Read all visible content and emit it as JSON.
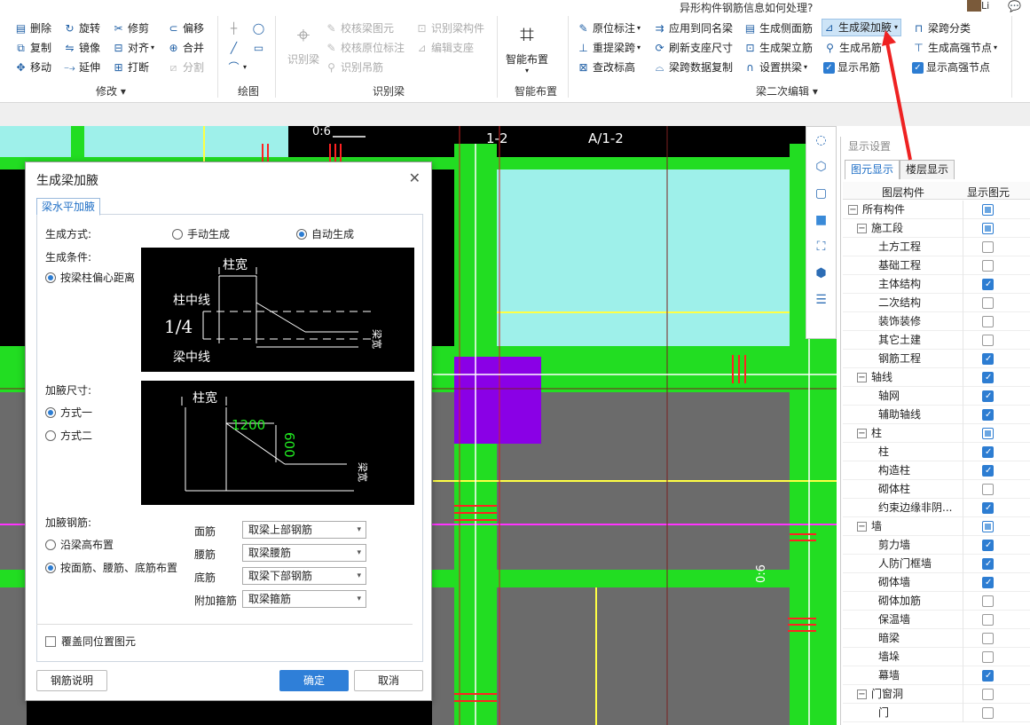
{
  "title_text": "异形构件钢筋信息如何处理?",
  "user": {
    "name": "Li"
  },
  "ribbon": {
    "modify": {
      "label": "修改",
      "buttons": [
        "删除",
        "旋转",
        "修剪",
        "偏移",
        "复制",
        "镜像",
        "对齐",
        "合并",
        "移动",
        "延伸",
        "打断",
        "分割"
      ]
    },
    "draw": {
      "label": "绘图"
    },
    "identify": {
      "label": "识别梁",
      "big_button": "识别梁",
      "buttons": [
        "校核梁图元",
        "识别梁构件",
        "校核原位标注",
        "编辑支座",
        "识别吊筋"
      ]
    },
    "smart": {
      "label": "智能布置",
      "big_button": "智能布置"
    },
    "edit2": {
      "label": "梁二次编辑",
      "buttons": [
        "原位标注",
        "应用到同名梁",
        "生成侧面筋",
        "生成梁加腋",
        "梁跨分类",
        "重提梁跨",
        "刷新支座尺寸",
        "生成架立筋",
        "生成吊筋",
        "生成高强节点",
        "查改标高",
        "梁跨数据复制",
        "设置拱梁"
      ],
      "checks": [
        "显示吊筋",
        "显示高强节点"
      ]
    }
  },
  "canvas": {
    "labels": [
      "1-2",
      "A/1-2",
      "0:6"
    ]
  },
  "panel": {
    "title": "显示设置",
    "tabs": [
      "图元显示",
      "楼层显示"
    ],
    "columns": [
      "图层构件",
      "显示图元"
    ],
    "rows": [
      {
        "label": "所有构件",
        "level": 0,
        "toggle": "−",
        "state": "part"
      },
      {
        "label": "施工段",
        "level": 1,
        "toggle": "−",
        "state": "part"
      },
      {
        "label": "土方工程",
        "level": 2,
        "state": "off"
      },
      {
        "label": "基础工程",
        "level": 2,
        "state": "off"
      },
      {
        "label": "主体结构",
        "level": 2,
        "state": "on"
      },
      {
        "label": "二次结构",
        "level": 2,
        "state": "off"
      },
      {
        "label": "装饰装修",
        "level": 2,
        "state": "off"
      },
      {
        "label": "其它土建",
        "level": 2,
        "state": "off"
      },
      {
        "label": "钢筋工程",
        "level": 2,
        "state": "on"
      },
      {
        "label": "轴线",
        "level": 1,
        "toggle": "−",
        "state": "on"
      },
      {
        "label": "轴网",
        "level": 2,
        "state": "on"
      },
      {
        "label": "辅助轴线",
        "level": 2,
        "state": "on"
      },
      {
        "label": "柱",
        "level": 1,
        "toggle": "−",
        "state": "part"
      },
      {
        "label": "柱",
        "level": 2,
        "state": "on"
      },
      {
        "label": "构造柱",
        "level": 2,
        "state": "on"
      },
      {
        "label": "砌体柱",
        "level": 2,
        "state": "off"
      },
      {
        "label": "约束边缘非阴...",
        "level": 2,
        "state": "on"
      },
      {
        "label": "墙",
        "level": 1,
        "toggle": "−",
        "state": "part"
      },
      {
        "label": "剪力墙",
        "level": 2,
        "state": "on"
      },
      {
        "label": "人防门框墙",
        "level": 2,
        "state": "on"
      },
      {
        "label": "砌体墙",
        "level": 2,
        "state": "on"
      },
      {
        "label": "砌体加筋",
        "level": 2,
        "state": "off"
      },
      {
        "label": "保温墙",
        "level": 2,
        "state": "off"
      },
      {
        "label": "暗梁",
        "level": 2,
        "state": "off"
      },
      {
        "label": "墙垛",
        "level": 2,
        "state": "off"
      },
      {
        "label": "幕墙",
        "level": 2,
        "state": "on"
      },
      {
        "label": "门窗洞",
        "level": 1,
        "toggle": "−",
        "state": "off"
      },
      {
        "label": "门",
        "level": 2,
        "state": "off"
      }
    ]
  },
  "dialog": {
    "title": "生成梁加腋",
    "tab": "梁水平加腋",
    "method_label": "生成方式:",
    "method_options": [
      "手动生成",
      "自动生成"
    ],
    "condition_label": "生成条件:",
    "condition_option": "按梁柱偏心距离",
    "size_label": "加腋尺寸:",
    "size_options": [
      "方式一",
      "方式二"
    ],
    "rebar_label": "加腋钢筋:",
    "rebar_options": [
      "沿梁高布置",
      "按面筋、腰筋、底筋布置"
    ],
    "fields": [
      {
        "label": "面筋",
        "value": "取梁上部钢筋"
      },
      {
        "label": "腰筋",
        "value": "取梁腰筋"
      },
      {
        "label": "底筋",
        "value": "取梁下部钢筋"
      },
      {
        "label": "附加箍筋",
        "value": "取梁箍筋"
      }
    ],
    "overwrite": "覆盖同位置图元",
    "diagram1": {
      "col_width": "柱宽",
      "col_center": "柱中线",
      "ratio": "1/4",
      "beam_center": "梁中线",
      "beam_width": "梁宽"
    },
    "diagram2": {
      "col_width": "柱宽",
      "len": "1200",
      "h": "600",
      "beam_width": "梁宽"
    },
    "buttons": {
      "help": "钢筋说明",
      "ok": "确定",
      "cancel": "取消"
    }
  }
}
